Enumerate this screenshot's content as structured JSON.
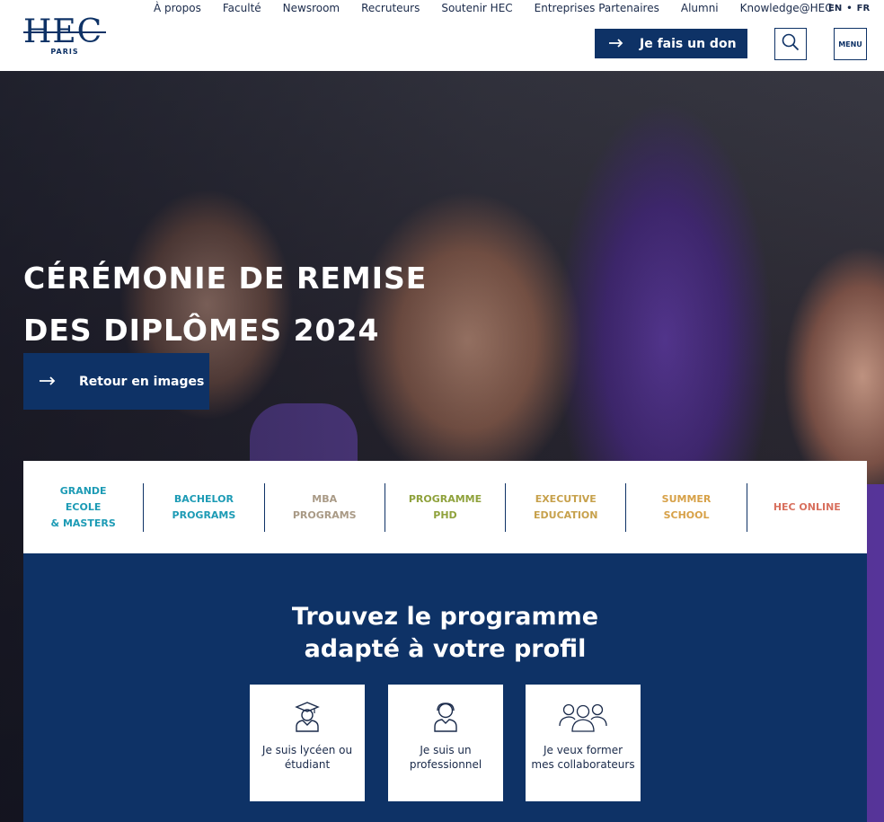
{
  "header": {
    "logo_text": "HEC",
    "logo_sub": "PARIS",
    "top_nav": [
      "À propos",
      "Faculté",
      "Newsroom",
      "Recruteurs",
      "Soutenir HEC",
      "Entreprises Partenaires",
      "Alumni",
      "Knowledge@HEC"
    ],
    "lang_en": "EN",
    "lang_sep": "•",
    "lang_fr": "FR",
    "donate_label": "Je fais un don",
    "menu_label": "MENU"
  },
  "hero": {
    "title_line1": "CÉRÉMONIE DE REMISE",
    "title_line2": "DES DIPLÔMES 2024",
    "cta_label": "Retour en images"
  },
  "programs": [
    {
      "label_lines": [
        "GRANDE",
        "ECOLE",
        "& MASTERS"
      ],
      "color": "#1d9bb5"
    },
    {
      "label_lines": [
        "BACHELOR",
        "PROGRAMS"
      ],
      "color": "#1d9bb5"
    },
    {
      "label_lines": [
        "MBA",
        "PROGRAMS"
      ],
      "color": "#a99a86"
    },
    {
      "label_lines": [
        "PROGRAMME",
        "PHD"
      ],
      "color": "#8fa23c"
    },
    {
      "label_lines": [
        "EXECUTIVE",
        "EDUCATION"
      ],
      "color": "#c7a14c"
    },
    {
      "label_lines": [
        "SUMMER",
        "SCHOOL"
      ],
      "color": "#d7a148"
    },
    {
      "label_lines": [
        "HEC ONLINE"
      ],
      "color": "#d8705e"
    }
  ],
  "finder": {
    "title_line1": "Trouvez le programme",
    "title_line2": "adapté à votre profil",
    "cards": [
      {
        "label": "Je suis lycéen ou étudiant",
        "icon": "graduate-icon"
      },
      {
        "label": "Je suis un professionnel",
        "icon": "professional-icon"
      },
      {
        "label": "Je veux former mes collaborateurs",
        "icon": "team-icon"
      }
    ]
  },
  "colors": {
    "brand_navy": "#0e3266"
  }
}
